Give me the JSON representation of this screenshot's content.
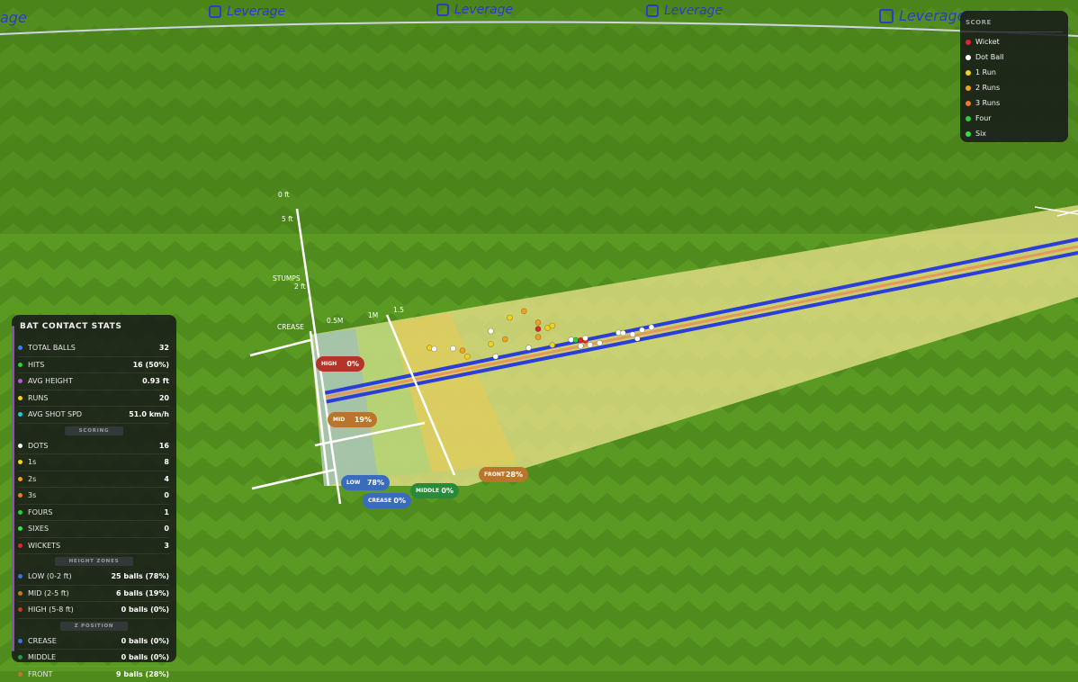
{
  "stadium": {
    "brand": "Leverage",
    "brand_fragment": "age"
  },
  "axis": {
    "height_labels": [
      "0 ft",
      "5 ft",
      "STUMPS",
      "2 ft",
      "CREASE"
    ],
    "distance_labels": [
      "0.5M",
      "1M",
      "1.5"
    ]
  },
  "legend": {
    "title": "SCORE",
    "items": [
      {
        "label": "Wicket",
        "color": "#e0252b"
      },
      {
        "label": "Dot Ball",
        "color": "#ffffff"
      },
      {
        "label": "1 Run",
        "color": "#f2d41a"
      },
      {
        "label": "2 Runs",
        "color": "#f0a21c"
      },
      {
        "label": "3 Runs",
        "color": "#f07a1c"
      },
      {
        "label": "Four",
        "color": "#2ccf3a"
      },
      {
        "label": "Six",
        "color": "#36e04a"
      }
    ]
  },
  "zones": {
    "high": {
      "label": "HIGH",
      "pct": "0%"
    },
    "mid": {
      "label": "MID",
      "pct": "19%"
    },
    "low": {
      "label": "LOW",
      "pct": "78%"
    },
    "crease": {
      "label": "CREASE",
      "pct": "0%"
    },
    "middle": {
      "label": "MIDDLE",
      "pct": "0%"
    },
    "front": {
      "label": "FRONT",
      "pct": "28%"
    }
  },
  "stats": {
    "title": "BAT CONTACT STATS",
    "rows": [
      {
        "label": "TOTAL BALLS",
        "value": "32",
        "color": "#3f7fe0"
      },
      {
        "label": "HITS",
        "value": "16 (50%)",
        "color": "#2ccf3a"
      },
      {
        "label": "AVG HEIGHT",
        "value": "0.93 ft",
        "color": "#b05ad8"
      },
      {
        "label": "RUNS",
        "value": "20",
        "color": "#f2d41a"
      },
      {
        "label": "AVG SHOT SPD",
        "value": "51.0 km/h",
        "color": "#26c6da"
      }
    ],
    "scoring_title": "SCORING",
    "scoring": [
      {
        "label": "DOTS",
        "value": "16",
        "color": "#ffffff"
      },
      {
        "label": "1s",
        "value": "8",
        "color": "#f2d41a"
      },
      {
        "label": "2s",
        "value": "4",
        "color": "#f0a21c"
      },
      {
        "label": "3s",
        "value": "0",
        "color": "#f07a1c"
      },
      {
        "label": "FOURS",
        "value": "1",
        "color": "#2ccf3a"
      },
      {
        "label": "SIXES",
        "value": "0",
        "color": "#36e04a"
      },
      {
        "label": "WICKETS",
        "value": "3",
        "color": "#e0252b"
      }
    ],
    "height_title": "HEIGHT ZONES",
    "height": [
      {
        "label": "LOW (0-2 ft)",
        "value": "25 balls (78%)",
        "color": "#3f6fd0"
      },
      {
        "label": "MID (2-5 ft)",
        "value": "6 balls (19%)",
        "color": "#c07a2c"
      },
      {
        "label": "HIGH (5-8 ft)",
        "value": "0 balls (0%)",
        "color": "#c0392b"
      }
    ],
    "z_title": "Z POSITION",
    "z": [
      {
        "label": "CREASE",
        "value": "0 balls (0%)",
        "color": "#3f6fd0"
      },
      {
        "label": "MIDDLE",
        "value": "0 balls (0%)",
        "color": "#2c9a3a"
      },
      {
        "label": "FRONT",
        "value": "9 balls (28%)",
        "color": "#c07a2c"
      }
    ]
  },
  "balls": [
    {
      "type": "2 Runs",
      "color": "#f0a21c",
      "depth_m": 1.45,
      "height_ft": 2.6
    },
    {
      "type": "1 Run",
      "color": "#f2d41a",
      "depth_m": 1.3,
      "height_ft": 2.3
    },
    {
      "type": "1 Run",
      "color": "#f2d41a",
      "depth_m": 0.45,
      "height_ft": 1.0
    },
    {
      "type": "Dot Ball",
      "color": "#ffffff",
      "depth_m": 0.5,
      "height_ft": 0.9
    },
    {
      "type": "Dot Ball",
      "color": "#ffffff",
      "depth_m": 0.7,
      "height_ft": 0.8
    },
    {
      "type": "2 Runs",
      "color": "#f0a21c",
      "depth_m": 0.8,
      "height_ft": 0.6
    },
    {
      "type": "1 Run",
      "color": "#f2d41a",
      "depth_m": 0.85,
      "height_ft": 0.2
    },
    {
      "type": "Dot Ball",
      "color": "#ffffff",
      "depth_m": 1.1,
      "height_ft": 1.6
    },
    {
      "type": "1 Run",
      "color": "#f2d41a",
      "depth_m": 1.1,
      "height_ft": 0.8
    },
    {
      "type": "2 Runs",
      "color": "#f0a21c",
      "depth_m": 1.25,
      "height_ft": 1.0
    },
    {
      "type": "Dot Ball",
      "color": "#ffffff",
      "depth_m": 1.15,
      "height_ft": 0.0
    },
    {
      "type": "2 Runs",
      "color": "#f0a21c",
      "depth_m": 1.6,
      "height_ft": 1.8
    },
    {
      "type": "Wicket",
      "color": "#e0252b",
      "depth_m": 1.6,
      "height_ft": 1.4
    },
    {
      "type": "1 Run",
      "color": "#f2d41a",
      "depth_m": 1.7,
      "height_ft": 1.4
    },
    {
      "type": "1 Run",
      "color": "#f2d41a",
      "depth_m": 1.75,
      "height_ft": 1.5
    },
    {
      "type": "2 Runs",
      "color": "#f0a21c",
      "depth_m": 1.6,
      "height_ft": 0.9
    },
    {
      "type": "Dot Ball",
      "color": "#ffffff",
      "depth_m": 1.5,
      "height_ft": 0.3
    },
    {
      "type": "1 Run",
      "color": "#f2d41a",
      "depth_m": 1.75,
      "height_ft": 0.3
    },
    {
      "type": "Dot Ball",
      "color": "#ffffff",
      "depth_m": 1.95,
      "height_ft": 0.5
    },
    {
      "type": "Four",
      "color": "#2ccf3a",
      "depth_m": 2.0,
      "height_ft": 0.45
    },
    {
      "type": "Wicket",
      "color": "#e0252b",
      "depth_m": 2.05,
      "height_ft": 0.4
    },
    {
      "type": "Wicket",
      "color": "#e0252b",
      "depth_m": 2.1,
      "height_ft": 0.35
    },
    {
      "type": "Dot Ball",
      "color": "#ffffff",
      "depth_m": 2.1,
      "height_ft": 0.5
    },
    {
      "type": "Dot Ball",
      "color": "#ffffff",
      "depth_m": 2.05,
      "height_ft": 0.05
    },
    {
      "type": "Dot Ball",
      "color": "#ffffff",
      "depth_m": 2.15,
      "height_ft": 0.05
    },
    {
      "type": "Dot Ball",
      "color": "#ffffff",
      "depth_m": 2.25,
      "height_ft": 0.1
    },
    {
      "type": "Dot Ball",
      "color": "#ffffff",
      "depth_m": 2.45,
      "height_ft": 0.6
    },
    {
      "type": "Dot Ball",
      "color": "#ffffff",
      "depth_m": 2.5,
      "height_ft": 0.55
    },
    {
      "type": "Dot Ball",
      "color": "#ffffff",
      "depth_m": 2.6,
      "height_ft": 0.4
    },
    {
      "type": "Dot Ball",
      "color": "#ffffff",
      "depth_m": 2.7,
      "height_ft": 0.6
    },
    {
      "type": "Dot Ball",
      "color": "#ffffff",
      "depth_m": 2.65,
      "height_ft": 0.1
    },
    {
      "type": "Dot Ball",
      "color": "#ffffff",
      "depth_m": 2.8,
      "height_ft": 0.7
    }
  ]
}
